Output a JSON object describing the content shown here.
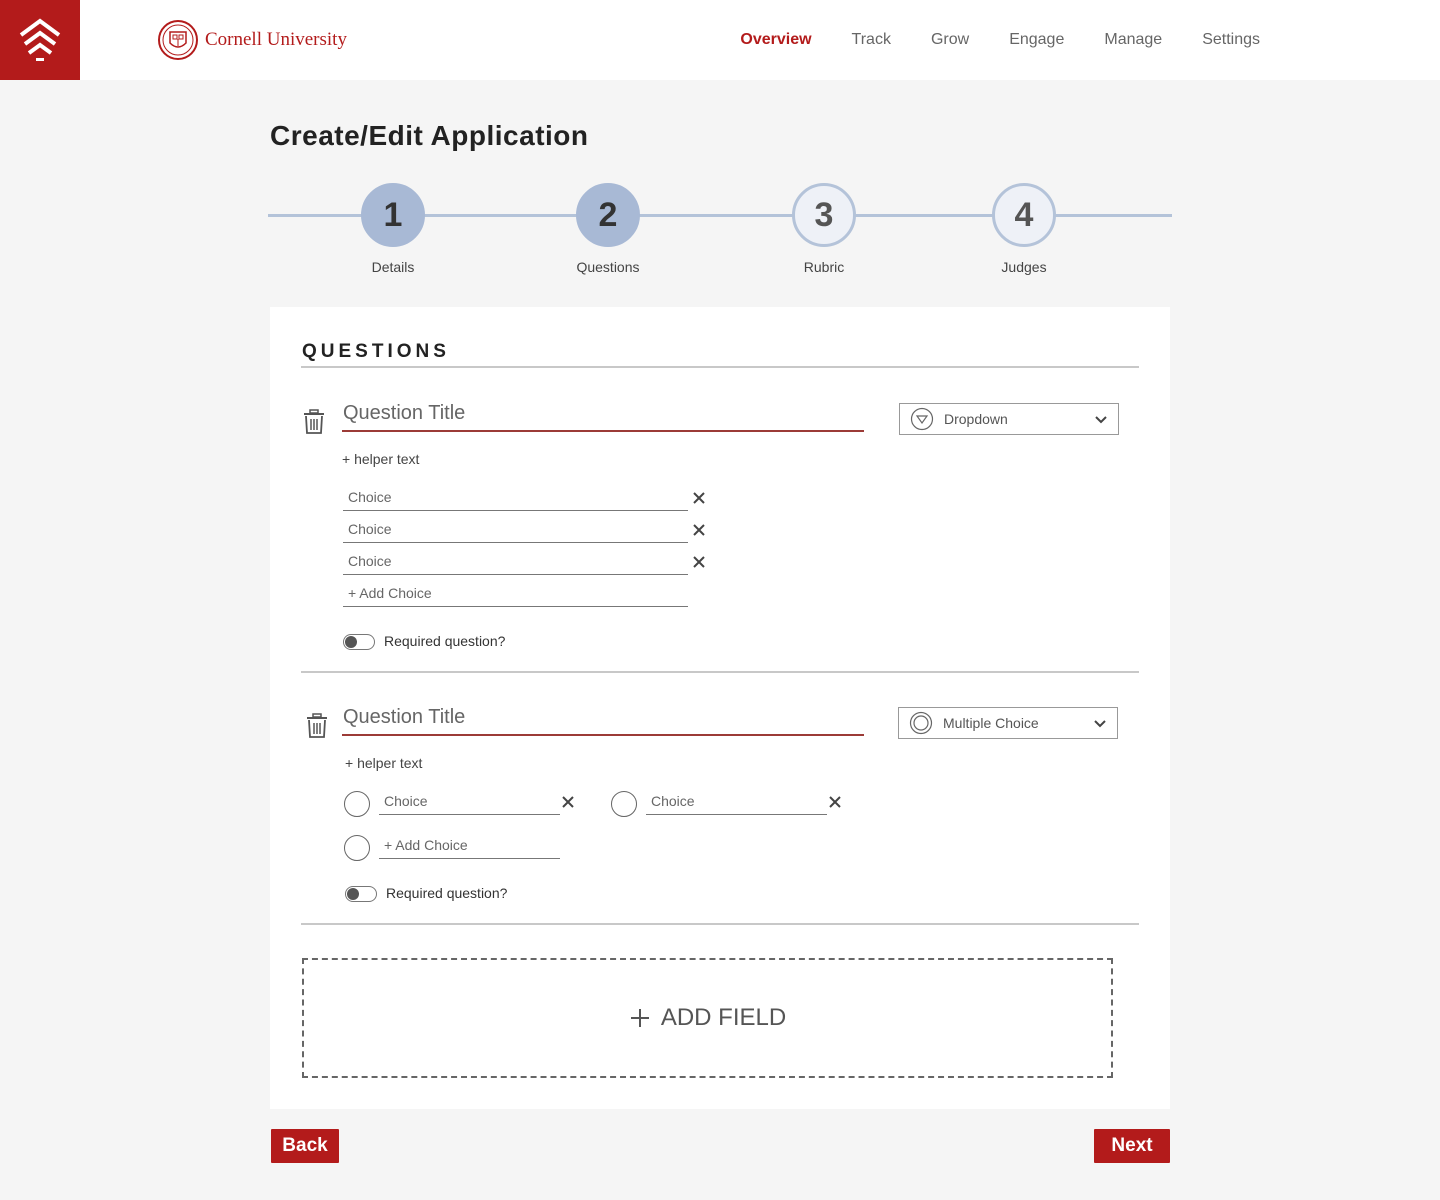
{
  "header": {
    "brand": "Cornell University",
    "nav": [
      "Overview",
      "Track",
      "Grow",
      "Engage",
      "Manage",
      "Settings"
    ],
    "active_nav": "Overview"
  },
  "page_title": "Create/Edit Application",
  "stepper": {
    "steps": [
      {
        "number": "1",
        "label": "Details",
        "state": "complete"
      },
      {
        "number": "2",
        "label": "Questions",
        "state": "current"
      },
      {
        "number": "3",
        "label": "Rubric",
        "state": "upcoming"
      },
      {
        "number": "4",
        "label": "Judges",
        "state": "upcoming"
      }
    ]
  },
  "section_title": "QUESTIONS",
  "questions": [
    {
      "title_placeholder": "Question Title",
      "helper": "+ helper text",
      "type": "Dropdown",
      "choices": [
        "Choice",
        "Choice",
        "Choice"
      ],
      "add_choice": "+ Add Choice",
      "required_label": "Required question?",
      "required": false
    },
    {
      "title_placeholder": "Question Title",
      "helper": "+ helper text",
      "type": "Multiple Choice",
      "choices": [
        "Choice",
        "Choice"
      ],
      "add_choice": "+ Add Choice",
      "required_label": "Required question?",
      "required": false
    }
  ],
  "add_field": {
    "icon": "plus-icon",
    "label": "ADD FIELD"
  },
  "buttons": {
    "back": "Back",
    "next": "Next"
  },
  "colors": {
    "brand": "#b31b1b",
    "step": "#a8b9d5",
    "background": "#f5f5f5"
  }
}
